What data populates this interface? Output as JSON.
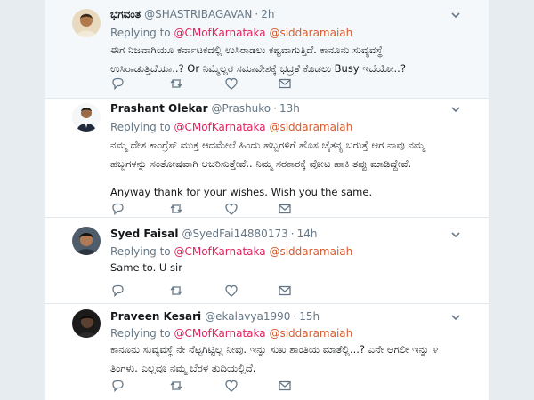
{
  "colors": {
    "mention": "#e0245e",
    "accent": "#1da1f2"
  },
  "icons": [
    "chevron-down-icon",
    "reply-icon",
    "retweet-icon",
    "like-icon",
    "message-icon"
  ],
  "tweets": [
    {
      "name": "ಭಗವಂತ",
      "handle": "@SHASTRIBAGAVAN",
      "time": "2h",
      "replying_prefix": "Replying to",
      "mentions": [
        "@CMofKarnataka",
        "@siddaramaiah"
      ],
      "text": [
        "ಈಗ ನಿಜವಾಗಿಯೂ ಕರ್ನಾಟಕದಲ್ಲಿ ಉಸಿರಾಡಲು ಕಷ್ಟವಾಗುತ್ತಿದೆ. ಕಾನೂನು ಸುವ್ಯವಸ್ಥೆ",
        "ಉಸಿರಾಡುತ್ತಿದೆಯಾ..? Or ನಿಮ್ಮೆಲ್ಲರ ಸಮಾವೇಶಕ್ಕೆ ಭದ್ರತೆ ಕೊಡಲು Busy ಇದೆಯೋ..?"
      ]
    },
    {
      "name": "Prashant Olekar",
      "handle": "@Prashuko",
      "time": "13h",
      "replying_prefix": "Replying to",
      "mentions": [
        "@CMofKarnataka",
        "@siddaramaiah"
      ],
      "text": [
        "ನಮ್ಮ ದೇಶ ಕಾಂಗ್ರೆಸ್ ಮುಕ್ತ ಆದಮೇಲೆ ಹಿಂದು ಹಬ್ಬಗಳಿಗೆ ಹೊಸ ಚೈತನ್ಯ ಬರುತ್ತೆ ಆಗ ನಾವು ನಮ್ಮ",
        "ಹಬ್ಬಗಳನ್ನು ಸಂತೋಷವಾಗಿ ಆಚರಿಸುತ್ತೇವೆ.. ನಿಮ್ಮ ಸರಕಾರಕ್ಕೆ ವೋಟ ಹಾಕಿ ತಪ್ಪು ಮಾಡಿದ್ದೇವೆ.",
        "Anyway thank for your wishes. Wish you the same."
      ]
    },
    {
      "name": "Syed Faisal",
      "handle": "@SyedFai14880173",
      "time": "14h",
      "replying_prefix": "Replying to",
      "mentions": [
        "@CMofKarnataka",
        "@siddaramaiah"
      ],
      "text": [
        "Same to. U sir"
      ]
    },
    {
      "name": "Praveen Kesari",
      "handle": "@ekalavya1990",
      "time": "15h",
      "replying_prefix": "Replying to",
      "mentions": [
        "@CMofKarnataka",
        "@siddaramaiah"
      ],
      "text": [
        "ಕಾನೂನು ಸುವ್ಯವಸ್ಥೆ ನೇ ನೆಟ್ಟಗಿಟ್ಟಿಲ್ಲ ನೀವು. ಇನ್ನು ಸುಖ ಶಾಂತಿಯ ಮಾತೆಲ್ಲಿ...? ಎನೇ ಆಗಲೀ ಇನ್ನು ೪",
        "ತಿಂಗಳು. ಎಲ್ಲವೂ ನಮ್ಮ ಬೆರಳ ತುದಿಯಲ್ಲಿದೆ."
      ]
    }
  ]
}
